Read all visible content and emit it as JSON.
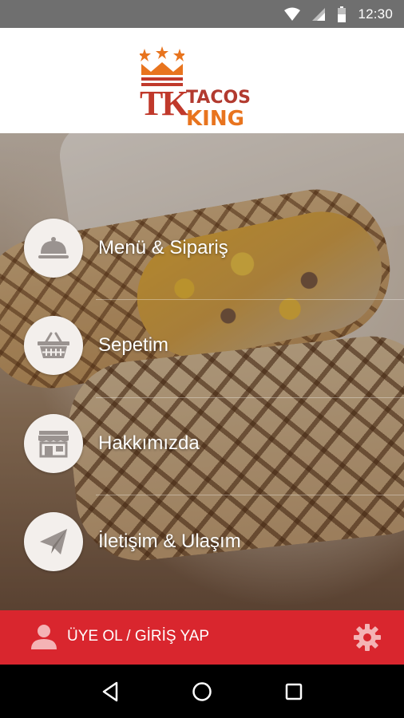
{
  "status_bar": {
    "time": "12:30",
    "icons": [
      "wifi-icon",
      "signal-icon",
      "battery-icon"
    ]
  },
  "header": {
    "logo_monogram": "TK",
    "logo_line1": "TACOS",
    "logo_line2": "KING"
  },
  "menu": {
    "items": [
      {
        "label": "Menü & Sipariş",
        "icon": "cloche-icon"
      },
      {
        "label": "Sepetim",
        "icon": "basket-icon"
      },
      {
        "label": "Hakkımızda",
        "icon": "storefront-icon"
      },
      {
        "label": "İletişim & Ulaşım",
        "icon": "paper-plane-icon"
      }
    ]
  },
  "bottom_bar": {
    "login_label": "ÜYE OL / GİRİŞ YAP",
    "accent_color": "#d9262e"
  },
  "nav_bar": {
    "buttons": [
      "back-icon",
      "home-icon",
      "recents-icon"
    ]
  }
}
